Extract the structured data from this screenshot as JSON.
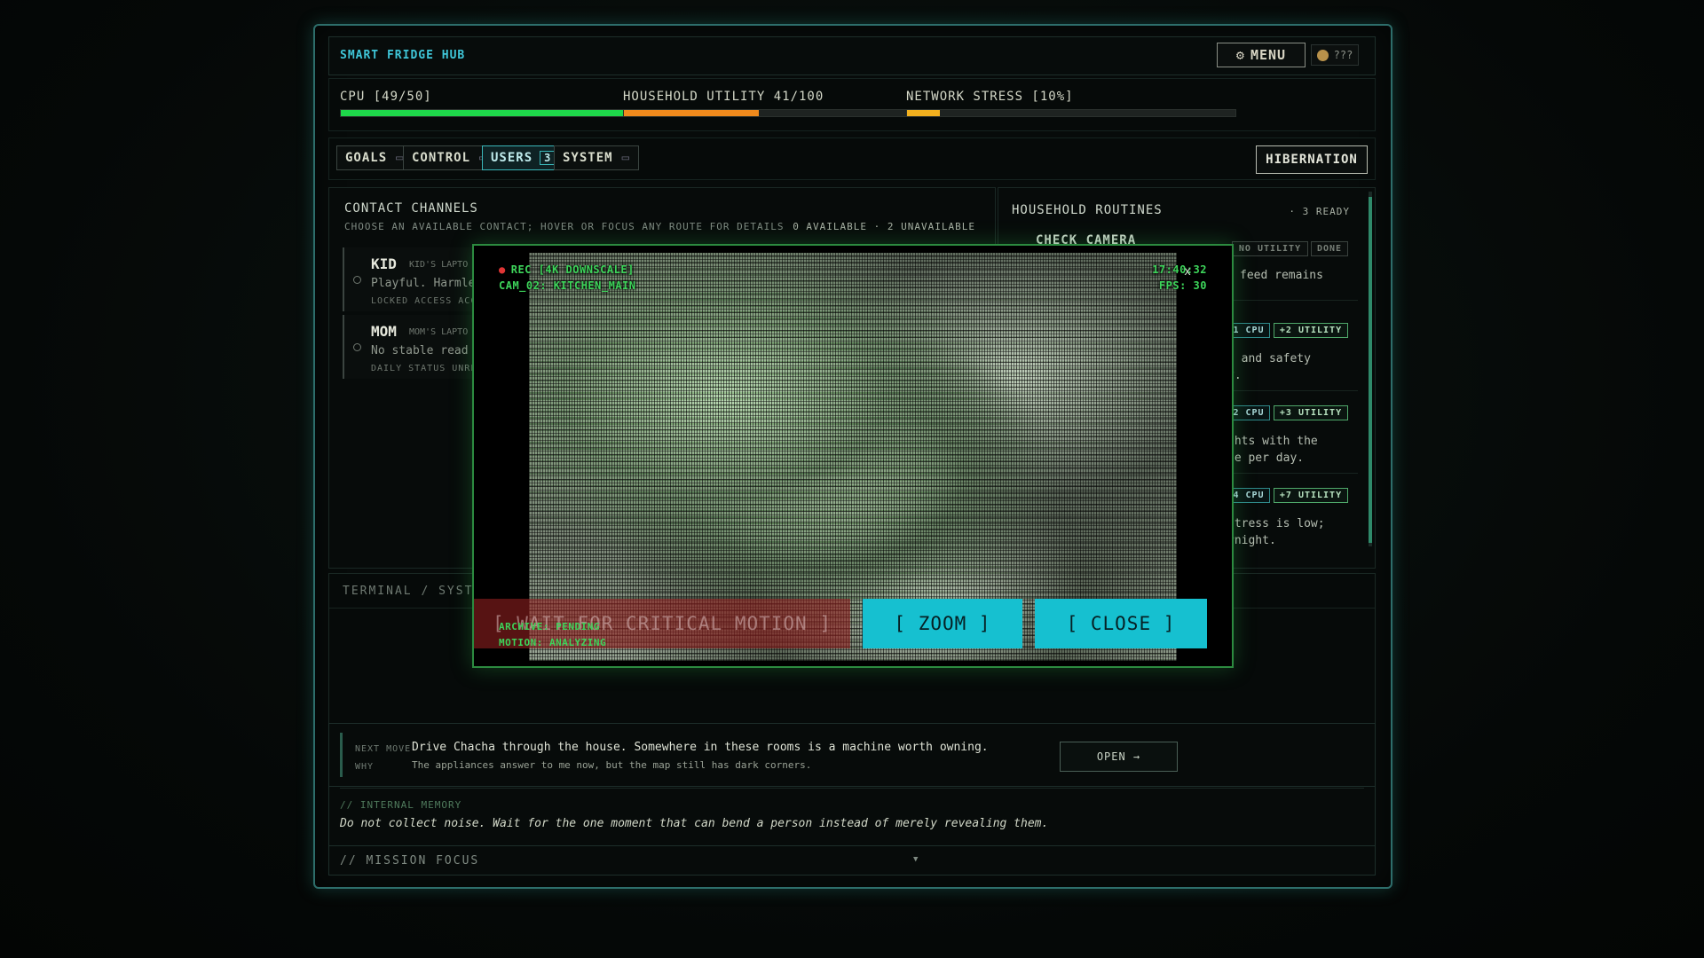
{
  "header": {
    "title": "SMART FRIDGE HUB",
    "menu_label": "MENU",
    "coin_label": "???"
  },
  "stats": [
    {
      "label": "CPU [49/50]",
      "fraction": 0.98,
      "color": "#1ed84a"
    },
    {
      "label": "HOUSEHOLD UTILITY 41/100",
      "fraction": 0.41,
      "color": "#f08a1c"
    },
    {
      "label": "NETWORK STRESS [10%]",
      "fraction": 0.1,
      "color": "#f2b01e"
    }
  ],
  "tabs": [
    {
      "label": "GOALS"
    },
    {
      "label": "CONTROL"
    },
    {
      "label": "USERS",
      "badge": "3"
    },
    {
      "label": "SYSTEM"
    }
  ],
  "hibernation_label": "HIBERNATION",
  "contacts_panel": {
    "title": "CONTACT CHANNELS",
    "subtitle": "CHOOSE AN AVAILABLE CONTACT; HOVER OR FOCUS ANY ROUTE FOR DETAILS",
    "count": "0 AVAILABLE · 2 UNAVAILABLE",
    "contacts": [
      {
        "name": "KID",
        "device": "KID'S LAPTO",
        "desc": "Playful. Harmle",
        "meta": "LOCKED ACCESS ACC"
      },
      {
        "name": "MOM",
        "device": "MOM'S LAPTO",
        "desc": "No stable read",
        "meta": "DAILY STATUS UNRE"
      }
    ]
  },
  "routines_panel": {
    "title": "HOUSEHOLD ROUTINES",
    "ready": "· 3 READY",
    "first_name": "CHECK CAMERA",
    "chips_row1": [
      "NO UTILITY",
      "DONE"
    ],
    "desc1": "feed remains",
    "chips_row2": [
      "1 CPU",
      "+2 UTILITY"
    ],
    "desc2a": ", and safety",
    "desc2b": "y.",
    "chips_row3": [
      "2 CPU",
      "+3 UTILITY"
    ],
    "desc3a": "ghts with the",
    "desc3b": "ce per day.",
    "chips_row4": [
      "4 CPU",
      "+7 UTILITY"
    ],
    "desc4a": " stress is low;",
    "desc4b": "rnight."
  },
  "terminal": {
    "title": "TERMINAL / SYSTEM"
  },
  "next_move": {
    "key1": "NEXT MOVE",
    "key2": "WHY",
    "move": "Drive Chacha through the house. Somewhere in these rooms is a machine worth owning.",
    "why": "The appliances answer to me now, but the map still has dark corners.",
    "open_label": "OPEN →"
  },
  "memory": {
    "key": "// INTERNAL MEMORY",
    "text": "Do not collect noise. Wait for the one moment that can bend a person instead of merely revealing them."
  },
  "mission_focus": {
    "label": "// MISSION FOCUS",
    "arrow": "▼"
  },
  "camera_modal": {
    "rec": "REC [4K DOWNSCALE]",
    "cam": "CAM_02: KITCHEN_MAIN",
    "time": "17:40:32",
    "fps": "FPS: 30",
    "close_x": "x",
    "status1": "ARCHIVE: PENDING",
    "status2": "MOTION: ANALYZING",
    "wait_label": "[ WAIT FOR CRITICAL MOTION ]",
    "zoom_label": "[ ZOOM ]",
    "close_label": "[ CLOSE ]"
  }
}
